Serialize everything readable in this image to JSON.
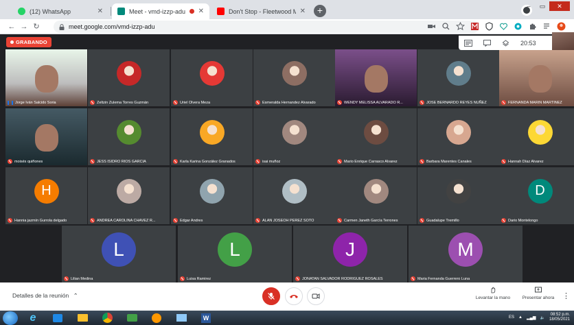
{
  "browser": {
    "tabs": [
      {
        "title": "(12) WhatsApp",
        "favicon_color": "#25d366",
        "active": false
      },
      {
        "title": "Meet - vmd-izzp-adu",
        "favicon_color": "#00897b",
        "active": true
      },
      {
        "title": "Don't Stop - Fleetwood Mac (Str...",
        "favicon_color": "#ff0000",
        "active": false
      }
    ],
    "url": "meet.google.com/vmd-izzp-adu"
  },
  "meet": {
    "recording_label": "GRABANDO",
    "clock": "20:53",
    "tiles": [
      {
        "name": "Jorge Iván Salcido Soria",
        "kind": "camera",
        "speaking": true
      },
      {
        "name": "Zeltzin Zulema Torres Guzmán",
        "kind": "photo",
        "color": "#c62828"
      },
      {
        "name": "Uriel Olvera Meza",
        "kind": "photo",
        "color": "#e53935"
      },
      {
        "name": "Esmeralda Hernandez Alvarado",
        "kind": "photo",
        "color": "#8d6e63"
      },
      {
        "name": "WENDY MELISSA ALVARADO R...",
        "kind": "camera"
      },
      {
        "name": "JOSE BERNARDO REYES NUÑEZ",
        "kind": "photo",
        "color": "#607d8b"
      },
      {
        "name": "FERNANDA MARIN MARTINEZ",
        "kind": "camera"
      },
      {
        "name": "moisés quiñones",
        "kind": "camera"
      },
      {
        "name": "JESS ISIDRO RIOS GARCIA",
        "kind": "photo",
        "color": "#558b2f"
      },
      {
        "name": "Karla Karina González Granados",
        "kind": "photo",
        "color": "#f9a825"
      },
      {
        "name": "isai muñoz",
        "kind": "photo",
        "color": "#a1887f"
      },
      {
        "name": "Mario Enrique Carrasco Alvarez",
        "kind": "photo",
        "color": "#6d4c41"
      },
      {
        "name": "Barbara Marentes Canales",
        "kind": "photo",
        "color": "#d7a790"
      },
      {
        "name": "Hannah Díaz Alvarez",
        "kind": "photo",
        "color": "#fdd835"
      },
      {
        "name": "Hannia jazmín Gurrola delgado",
        "kind": "letter",
        "letter": "H",
        "color": "#f57c00"
      },
      {
        "name": "ANDREA CAROLINA CHAVEZ R...",
        "kind": "photo",
        "color": "#bcaaa4"
      },
      {
        "name": "Edgar Andres",
        "kind": "photo",
        "color": "#90a4ae"
      },
      {
        "name": "ALAN JOSEOH PEREZ SOTO",
        "kind": "photo",
        "color": "#b0bec5"
      },
      {
        "name": "Carmen Janeth García Terrones",
        "kind": "photo",
        "color": "#a1887f"
      },
      {
        "name": "Guadalupe Tremillo",
        "kind": "photo",
        "color": "#424242"
      },
      {
        "name": "Dario Montelongo",
        "kind": "letter",
        "letter": "D",
        "color": "#00897b"
      },
      {
        "name": "Lilian Medina",
        "kind": "letter",
        "letter": "L",
        "color": "#3f51b5"
      },
      {
        "name": "Luisa Ramirez",
        "kind": "letter",
        "letter": "L",
        "color": "#43a047"
      },
      {
        "name": "JONATAN SALVADOR RODRIGUEZ ROSALES",
        "kind": "letter",
        "letter": "J",
        "color": "#8e24aa"
      },
      {
        "name": "Maria Fernanda Guerrero Luna",
        "kind": "letter",
        "letter": "M",
        "color": "#9c4fb0"
      }
    ],
    "details_label": "Detalles de la reunión",
    "raise_hand_label": "Levantar la mano",
    "present_label": "Presentar ahora"
  },
  "taskbar": {
    "language": "ES",
    "time": "08:52 p.m.",
    "date": "18/05/2021"
  }
}
